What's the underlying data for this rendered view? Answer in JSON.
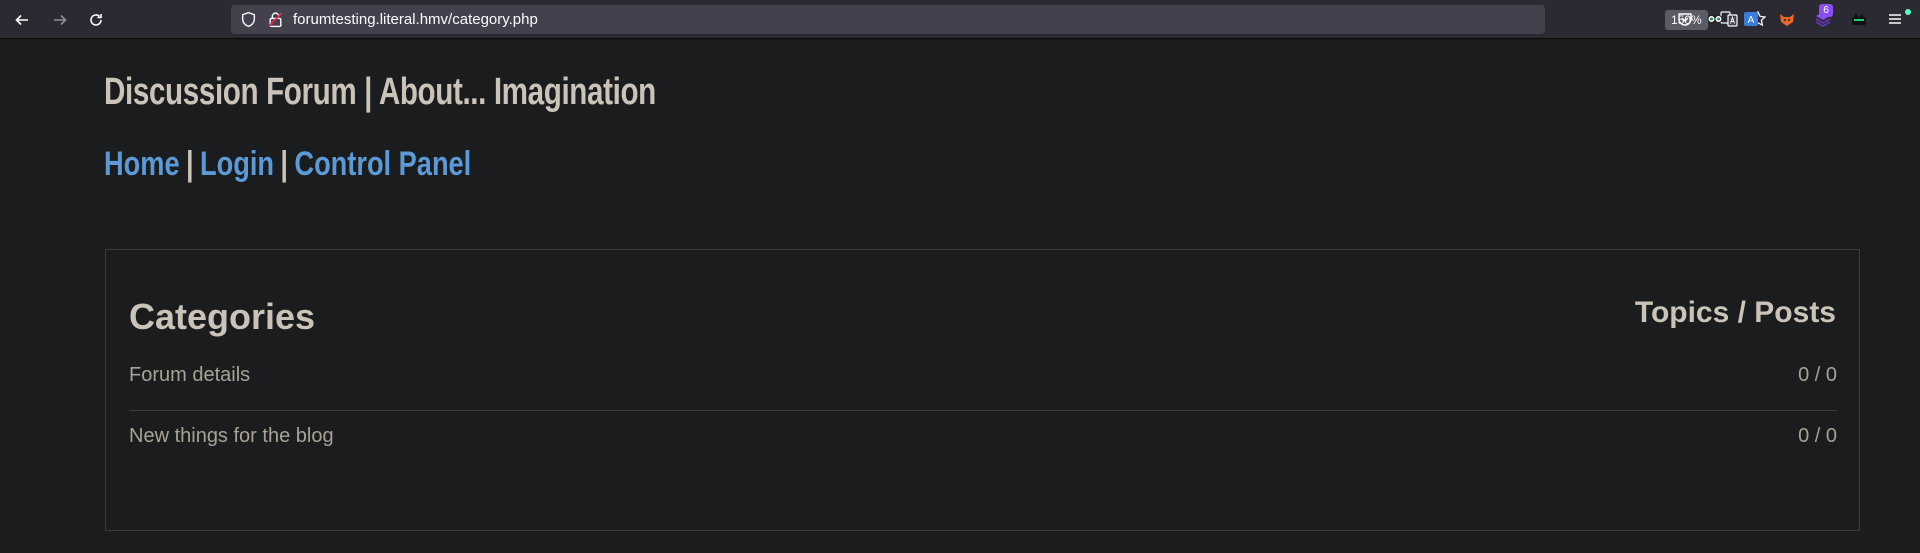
{
  "browser": {
    "url": "forumtesting.literal.hmv/category.php",
    "zoom": "150%",
    "extension_badge": "6"
  },
  "site": {
    "title": "Discussion Forum | About... Imagination",
    "nav": [
      {
        "label": "Home"
      },
      {
        "label": "Login"
      },
      {
        "label": "Control Panel"
      }
    ],
    "nav_separator": "|"
  },
  "categories": {
    "heading": "Categories",
    "heading_right": "Topics / Posts",
    "rows": [
      {
        "name": "Forum details",
        "count": "0 / 0"
      },
      {
        "name": "New things for the blog",
        "count": "0 / 0"
      }
    ]
  },
  "colors": {
    "page_bg": "#1b1c1e",
    "link": "#5b9ad6",
    "title_text": "#c9c3b8",
    "row_text": "#a8a296"
  }
}
